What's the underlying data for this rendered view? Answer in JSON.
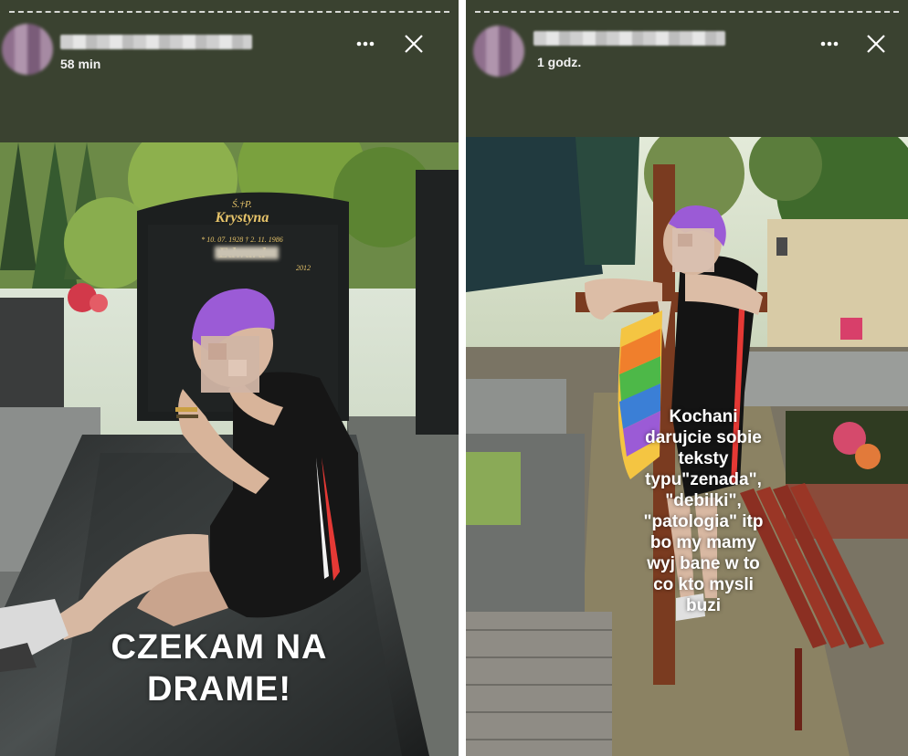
{
  "left_story": {
    "time": "58 min",
    "caption": [
      "CZEKAM NA",
      "DRAME!"
    ],
    "headstone": {
      "line1": "Ś.†P.",
      "line2": "Krystyna",
      "line3": "* 10. 07. 1928  † 2. 11. 1986",
      "line4": "Edward",
      "line5": "2012"
    }
  },
  "right_story": {
    "time": "1 godz.",
    "caption": [
      "Kochani",
      "darujcie sobie",
      "teksty",
      "typu\"zenada\",",
      "\"debilki\",",
      "\"patologia\" itp",
      "bo my mamy",
      "wyj bane w to",
      "co kto mysli",
      "buzi"
    ]
  },
  "icons": {
    "more": "more-options-icon",
    "close": "close-icon"
  },
  "colors": {
    "header_bg": "#3a4230",
    "text": "#ffffff",
    "hair": "#9b5bd6"
  }
}
